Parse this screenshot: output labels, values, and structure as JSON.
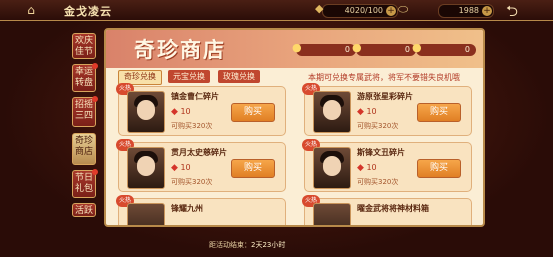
{
  "header": {
    "title": "金戈凌云",
    "stamina": "4020/100",
    "currency": "1988"
  },
  "sidebar": {
    "items": [
      {
        "label": "欢庆佳节",
        "active": false,
        "dot": false
      },
      {
        "label": "幸运转盘",
        "active": false,
        "dot": true
      },
      {
        "label": "招摇三四",
        "active": false,
        "dot": true
      },
      {
        "label": "奇珍商店",
        "active": true,
        "dot": false
      },
      {
        "label": "节日礼包",
        "active": false,
        "dot": true
      },
      {
        "label": "活跃",
        "active": false,
        "dot": false
      }
    ]
  },
  "shop": {
    "title": "奇珍商店",
    "currencies": [
      {
        "icon": "coin-icon",
        "value": "0"
      },
      {
        "icon": "coin-icon",
        "value": "0"
      },
      {
        "icon": "coin-icon",
        "value": "0"
      }
    ],
    "tabs": [
      {
        "label": "奇珍兑换",
        "active": true
      },
      {
        "label": "元宝兑换",
        "active": false
      },
      {
        "label": "玫瑰兑换",
        "active": false
      }
    ],
    "notice": "本期可兑换专属武将，将军不要错失良机哦",
    "buy_label": "购买",
    "items": [
      {
        "badge": "火热",
        "name": "镇金曹仁碎片",
        "price": "10",
        "limit": "可购买320次"
      },
      {
        "badge": "火热",
        "name": "游原张星彩碎片",
        "price": "10",
        "limit": "可购买320次"
      },
      {
        "badge": "火热",
        "name": "贯月太史慈碎片",
        "price": "10",
        "limit": "可购买320次"
      },
      {
        "badge": "火热",
        "name": "斯锋文丑碎片",
        "price": "10",
        "limit": "可购买320次"
      },
      {
        "badge": "火热",
        "name": "锋耀九州",
        "price": "",
        "limit": ""
      },
      {
        "badge": "火热",
        "name": "曜金武将将神材料箱",
        "price": "",
        "limit": ""
      }
    ]
  },
  "footer": {
    "countdown_label": "距活动结束：",
    "countdown_value": "2天23小时"
  },
  "colors": {
    "accent": "#c0472f",
    "buy_button": "#e88a2e",
    "panel_bg": "#fbeed5"
  }
}
